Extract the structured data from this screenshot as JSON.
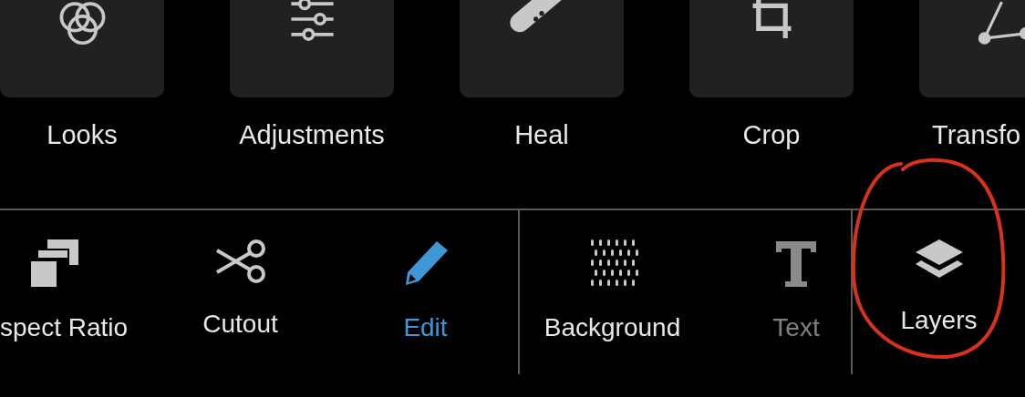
{
  "tools": [
    {
      "label": "Looks"
    },
    {
      "label": "Adjustments"
    },
    {
      "label": "Heal"
    },
    {
      "label": "Crop"
    },
    {
      "label": "Transfo"
    }
  ],
  "groups": [
    {
      "items": [
        {
          "label": "spect Ratio",
          "selected": false,
          "disabled": false
        },
        {
          "label": "Cutout",
          "selected": false,
          "disabled": false
        },
        {
          "label": "Edit",
          "selected": true,
          "disabled": false
        }
      ]
    },
    {
      "items": [
        {
          "label": "Background",
          "selected": false,
          "disabled": false
        },
        {
          "label": "Text",
          "selected": false,
          "disabled": true
        }
      ]
    },
    {
      "items": [
        {
          "label": "Layers",
          "selected": false,
          "disabled": false
        }
      ]
    }
  ]
}
